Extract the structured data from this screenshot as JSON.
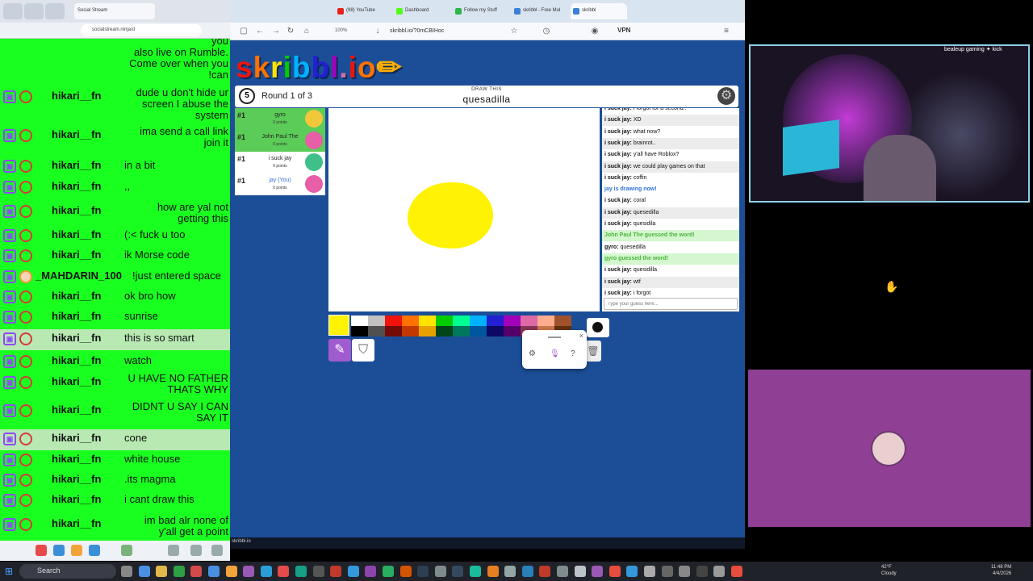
{
  "chat_overlay": {
    "tab_title": "Social Stream",
    "url": "socialstream.ninja/d",
    "top_fragment": [
      "you",
      "also live on Rumble.",
      "Come over when you",
      "!can"
    ],
    "messages": [
      {
        "user": "hikari__fn",
        "text": "dude u don't hide ur screen I abuse the system",
        "align": "right",
        "highlight": false
      },
      {
        "user": "hikari__fn",
        "text": "ima send a call link join it",
        "align": "right",
        "highlight": false
      },
      {
        "user": "hikari__fn",
        "text": "in a bit",
        "align": "left",
        "highlight": false
      },
      {
        "user": "hikari__fn",
        "text": ",,",
        "align": "left",
        "highlight": false
      },
      {
        "user": "hikari__fn",
        "text": "how are yal not getting this",
        "align": "right",
        "highlight": false
      },
      {
        "user": "hikari__fn",
        "text": "(:< fuck u too",
        "align": "left",
        "highlight": false
      },
      {
        "user": "hikari__fn",
        "text": "ik Morse code",
        "align": "left",
        "highlight": false
      },
      {
        "user": "_MAHDARIN_100",
        "text": "!just entered space",
        "align": "left",
        "highlight": false
      },
      {
        "user": "hikari__fn",
        "text": "ok bro how",
        "align": "left",
        "highlight": false
      },
      {
        "user": "hikari__fn",
        "text": "sunrise",
        "align": "left",
        "highlight": false
      },
      {
        "user": "hikari__fn",
        "text": "this is so smart",
        "align": "left",
        "highlight": true
      },
      {
        "user": "hikari__fn",
        "text": "watch",
        "align": "left",
        "highlight": false
      },
      {
        "user": "hikari__fn",
        "text": "U HAVE NO FATHER THATS WHY",
        "align": "right",
        "highlight": false
      },
      {
        "user": "hikari__fn",
        "text": "DIDNT U SAY I CAN SAY IT",
        "align": "right",
        "highlight": false
      },
      {
        "user": "hikari__fn",
        "text": "cone",
        "align": "left",
        "highlight": true
      },
      {
        "user": "hikari__fn",
        "text": "white house",
        "align": "left",
        "highlight": false
      },
      {
        "user": "hikari__fn",
        "text": ".its magma",
        "align": "left",
        "highlight": false
      },
      {
        "user": "hikari__fn",
        "text": "i cant draw this",
        "align": "left",
        "highlight": false
      },
      {
        "user": "hikari__fn",
        "text": "im bad alr none of y'all get a point",
        "align": "right",
        "highlight": false
      }
    ]
  },
  "browser": {
    "tabs": [
      {
        "label": "(98) YouTube",
        "color": "#e62117"
      },
      {
        "label": "Dashboard",
        "color": "#53fc18"
      },
      {
        "label": "Follow my Stuff",
        "color": "#2fb54a"
      },
      {
        "label": "skribbl - Free Mul",
        "color": "#3b7fd6"
      },
      {
        "label": "skribbl",
        "color": "#3b7fd6"
      }
    ],
    "url": "skribbl.io/?0mCBIHoc",
    "zoom": "100%",
    "vpn_label": "VPN",
    "status_url": "skribbl.io"
  },
  "game": {
    "logo": "skribbl.io",
    "timer": "5",
    "round_text": "Round 1 of 3",
    "hint_label": "DRAW THIS",
    "word": "quesadilla",
    "players": [
      {
        "rank": "#1",
        "name": "gyro",
        "points": "0 points",
        "state": "guessed",
        "avatar_color": "#f2c83a"
      },
      {
        "rank": "#1",
        "name": "John Paul The",
        "points": "0 points",
        "state": "guessed",
        "avatar_color": "#e65fa8"
      },
      {
        "rank": "#1",
        "name": "i suck jay",
        "points": "0 points",
        "state": "idle",
        "avatar_color": "#3fc08a"
      },
      {
        "rank": "#1",
        "name": "jay (You)",
        "points": "0 points",
        "state": "drawing",
        "avatar_color": "#e65fa8"
      }
    ],
    "chat": [
      {
        "who": "i suck jay:",
        "text": "i forgot for a second..",
        "kind": "msg"
      },
      {
        "who": "i suck jay:",
        "text": "XD",
        "kind": "msg"
      },
      {
        "who": "i suck jay:",
        "text": "what now?",
        "kind": "msg"
      },
      {
        "who": "i suck jay:",
        "text": "brainrot..",
        "kind": "msg"
      },
      {
        "who": "i suck jay:",
        "text": "y'all have Roblox?",
        "kind": "msg"
      },
      {
        "who": "i suck jay:",
        "text": "we could play games on that",
        "kind": "msg"
      },
      {
        "who": "i suck jay:",
        "text": "coffin",
        "kind": "msg"
      },
      {
        "who": "",
        "text": "jay is drawing now!",
        "kind": "draw"
      },
      {
        "who": "i suck jay:",
        "text": "coral",
        "kind": "msg"
      },
      {
        "who": "i suck jay:",
        "text": "quesedilla",
        "kind": "msg"
      },
      {
        "who": "i suck jay:",
        "text": "quesidila",
        "kind": "msg"
      },
      {
        "who": "",
        "text": "John Paul The guessed the word!",
        "kind": "guess"
      },
      {
        "who": "gyro:",
        "text": "quesedilla",
        "kind": "msg"
      },
      {
        "who": "",
        "text": "gyro guessed the word!",
        "kind": "guess"
      },
      {
        "who": "i suck jay:",
        "text": "quesidilla",
        "kind": "msg"
      },
      {
        "who": "i suck jay:",
        "text": "wtf",
        "kind": "msg"
      },
      {
        "who": "i suck jay:",
        "text": "i forgot",
        "kind": "msg"
      }
    ],
    "guess_placeholder": "Type your guess here...",
    "palette_top": [
      "#ffffff",
      "#c1c1c1",
      "#ef130b",
      "#ff7100",
      "#ffe400",
      "#00cc00",
      "#00ff91",
      "#00b2ff",
      "#231fd3",
      "#a300ba",
      "#df69a7",
      "#ffac8e",
      "#a0522d"
    ],
    "palette_bottom": [
      "#000000",
      "#505050",
      "#740b07",
      "#c23800",
      "#e8a200",
      "#004619",
      "#00785d",
      "#00569e",
      "#0e0865",
      "#550069",
      "#873554",
      "#cc774d",
      "#63300d"
    ],
    "current_color": "#fff203",
    "drawing_fill": "#fff203"
  },
  "streams": {
    "cam_caption": "bealeup gaming ✦ kick"
  },
  "taskbar": {
    "search_label": "Search",
    "weather": [
      "42°F",
      "Cloudy"
    ],
    "clock": [
      "11:48 PM",
      "4/4/2026"
    ]
  }
}
